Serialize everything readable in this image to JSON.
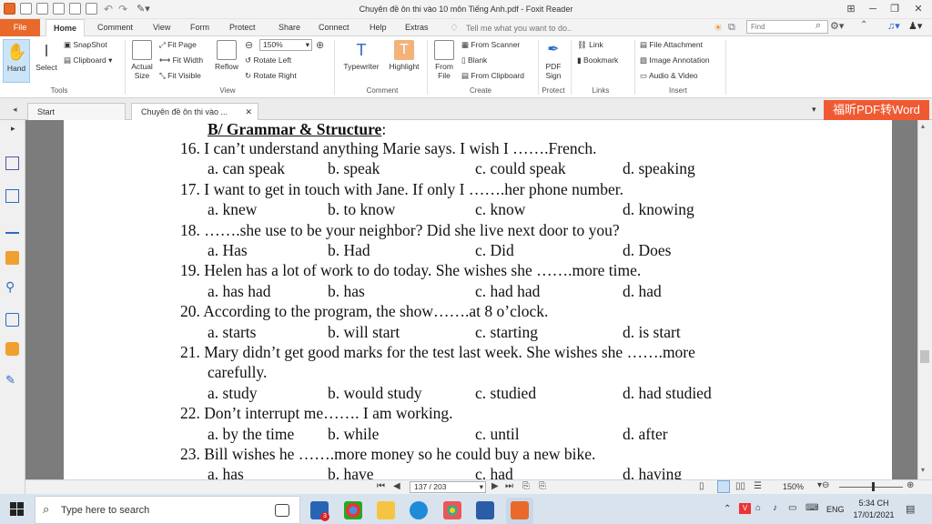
{
  "window": {
    "title": "Chuyên đề ôn thi vào 10 môn Tiếng Anh.pdf - Foxit Reader"
  },
  "menu_tabs": [
    "File",
    "Home",
    "Comment",
    "View",
    "Form",
    "Protect",
    "Share",
    "Connect",
    "Help",
    "Extras"
  ],
  "tell_me": "Tell me what you want to do..",
  "find_placeholder": "Find",
  "ribbon": {
    "tools": {
      "hand": "Hand",
      "select": "Select",
      "snapshot": "SnapShot",
      "clipboard": "Clipboard",
      "label": "Tools"
    },
    "view": {
      "actual_size_1": "Actual",
      "actual_size_2": "Size",
      "fit_page": "Fit Page",
      "fit_width": "Fit Width",
      "fit_visible": "Fit Visible",
      "reflow": "Reflow",
      "zoom": "150%",
      "rotate_left": "Rotate Left",
      "rotate_right": "Rotate Right",
      "label": "View"
    },
    "comment": {
      "typewriter": "Typewriter",
      "highlight": "Highlight",
      "label": "Comment"
    },
    "create": {
      "from_file_1": "From",
      "from_file_2": "File",
      "from_scanner": "From Scanner",
      "blank": "Blank",
      "from_clipboard": "From Clipboard",
      "label": "Create"
    },
    "protect": {
      "pdf_sign_1": "PDF",
      "pdf_sign_2": "Sign",
      "label": "Protect"
    },
    "links": {
      "link": "Link",
      "bookmark": "Bookmark",
      "label": "Links"
    },
    "insert": {
      "file_attachment": "File Attachment",
      "image_annotation": "Image Annotation",
      "audio_video": "Audio & Video",
      "label": "Insert"
    }
  },
  "doc_tabs": [
    "Start",
    "Chuyên đề ôn thi vào ..."
  ],
  "ad_banner": "福昕PDF转Word",
  "document": {
    "heading_prefix": "B/ Grammar & Structure",
    "heading_colon": ":",
    "lines": [
      {
        "q": "16. I can’t understand anything Marie says. I wish I …….French.",
        "a": "a. can speak",
        "b": "b. speak",
        "c": "c. could speak",
        "d": "d. speaking"
      },
      {
        "q": "17. I want to get in touch with Jane. If only I …….her phone number.",
        "a": "a. knew",
        "b": "b. to know",
        "c": "c. know",
        "d": "d. knowing"
      },
      {
        "q": "18. …….she use to be your neighbor? Did she live next door to you?",
        "a": "a. Has",
        "b": "b. Had",
        "c": "c. Did",
        "d": "d. Does"
      },
      {
        "q": "19. Helen has a lot of work to do today. She wishes she …….more time.",
        "a": "a. has had",
        "b": "b. has",
        "c": "c. had had",
        "d": "d. had"
      },
      {
        "q": "20. According to the program, the show…….at 8 o’clock.",
        "a": "a. starts",
        "b": "b. will start",
        "c": "c. starting",
        "d": "d. is start"
      },
      {
        "q": "21. Mary didn’t get good marks for the test last week. She wishes she …….more",
        "q2": "carefully.",
        "a": "a. study",
        "b": "b. would study",
        "c": "c. studied",
        "d": "d. had studied"
      },
      {
        "q": "22. Don’t interrupt me……. I am working.",
        "a": "a. by the time",
        "b": "b. while",
        "c": "c. until",
        "d": "d. after"
      },
      {
        "q": "23. Bill wishes he …….more money so he could buy a new bike.",
        "a": "a. has",
        "b": "b. have",
        "c": "c. had",
        "d": "d. having"
      }
    ]
  },
  "status": {
    "page": "137 / 203",
    "zoom": "150%"
  },
  "taskbar": {
    "search": "Type here to search",
    "lang": "ENG",
    "time": "5:34 CH",
    "date": "17/01/2021",
    "badge": "3"
  },
  "colors": {
    "accent": "#e8692a",
    "ad": "#f05a32",
    "taskbar": "#d9e3ee"
  }
}
